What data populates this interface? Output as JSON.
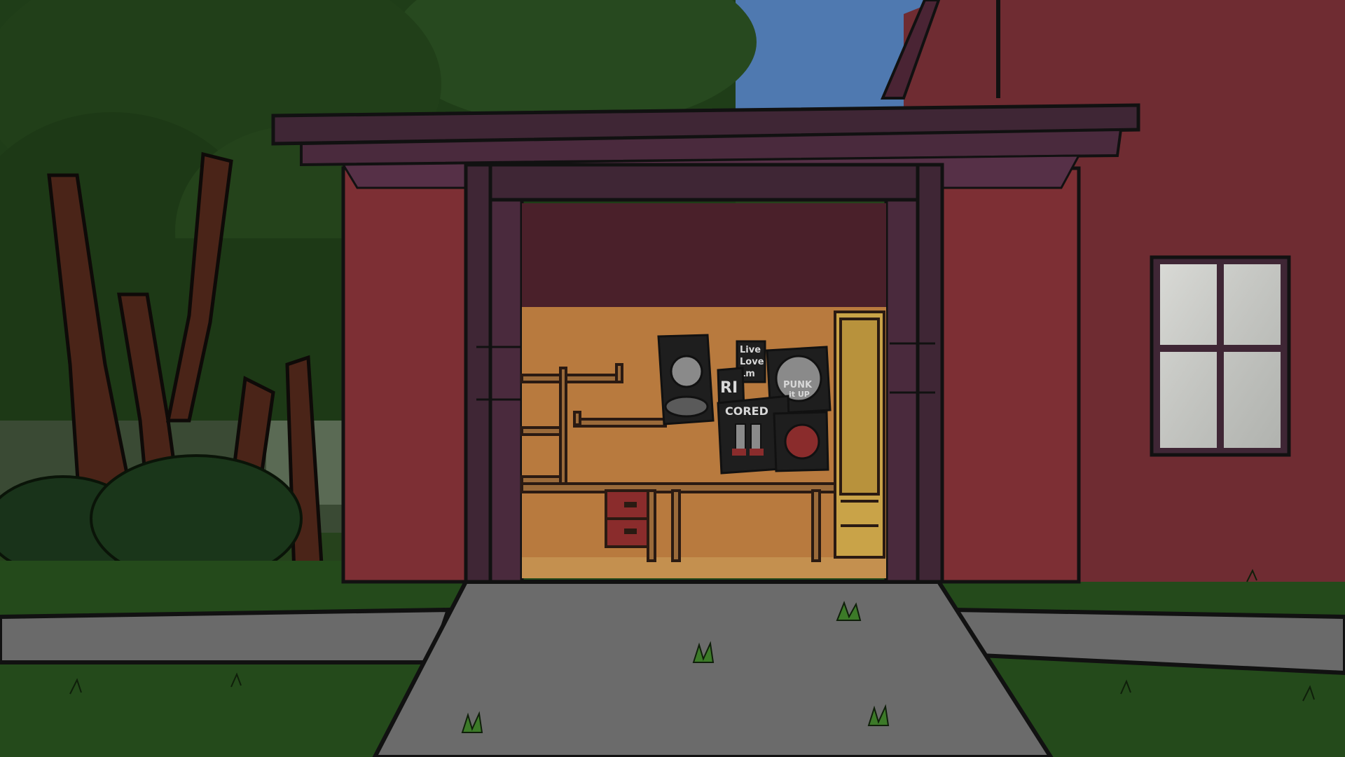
{
  "scene": {
    "description_free": true,
    "colors": {
      "sky": "#4f79b0",
      "foliage_dark": "#1d3a17",
      "foliage_mid": "#2c4f22",
      "house_red": "#6f2c32",
      "garage_wall": "#7d2f34",
      "trim_purple": "#3f2635",
      "interior_back": "#4a202a",
      "pegboard": "#b87a3e",
      "floor": "#c4904f",
      "driveway": "#6b6b6b",
      "grass": "#244a1b",
      "window_glass": "#c9cbc6"
    }
  },
  "posters": {
    "live_love": [
      "Live",
      "Love",
      "Lm"
    ],
    "punk": [
      "PUNK",
      "it UP"
    ],
    "ri": "RI",
    "cored": "CORED"
  }
}
